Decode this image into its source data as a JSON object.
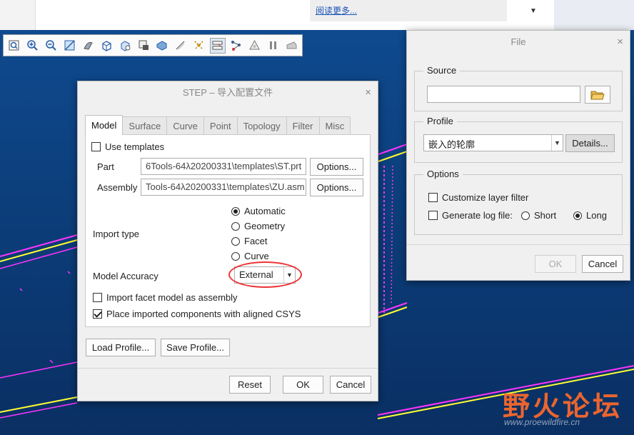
{
  "browser": {
    "read_more": "阅读更多...",
    "dropdown_arrow": "▼"
  },
  "toolbar": {
    "icons": [
      "zoom-fit-icon",
      "zoom-in-icon",
      "zoom-out-icon",
      "repaint-icon",
      "shading-icon",
      "display-style-icon",
      "saved-views-icon",
      "view-manager-icon",
      "perspective-icon",
      "datum-display-icon",
      "spin-center-icon",
      "annotation-display-icon",
      "network-icon",
      "appearance-icon",
      "pause-icon",
      "eraser-icon"
    ]
  },
  "step_dialog": {
    "title": "STEP – 导入配置文件",
    "close": "×",
    "tabs": [
      "Model",
      "Surface",
      "Curve",
      "Point",
      "Topology",
      "Filter",
      "Misc"
    ],
    "active_tab": "Model",
    "use_templates_label": "Use templates",
    "use_templates_checked": false,
    "part_label": "Part",
    "part_value": "6Tools-64λ20200331\\templates\\ST.prt",
    "assembly_label": "Assembly",
    "assembly_value": "Tools-64λ20200331\\templates\\ZU.asm",
    "options_label": "Options...",
    "import_type_label": "Import type",
    "import_types": [
      "Automatic",
      "Geometry",
      "Facet",
      "Curve"
    ],
    "import_type_selected": "Automatic",
    "model_accuracy_label": "Model Accuracy",
    "model_accuracy_value": "External",
    "import_facet_label": "Import facet model as assembly",
    "import_facet_checked": false,
    "place_aligned_label": "Place imported components with aligned CSYS",
    "place_aligned_checked": true,
    "load_profile": "Load Profile...",
    "save_profile": "Save Profile...",
    "reset": "Reset",
    "ok": "OK",
    "cancel": "Cancel"
  },
  "file_dialog": {
    "title": "File",
    "close": "×",
    "source_label": "Source",
    "source_value": "",
    "profile_label": "Profile",
    "profile_value": "嵌入的轮廓",
    "details_label": "Details...",
    "options_label": "Options",
    "customize_layer_filter": "Customize layer filter",
    "generate_log_file": "Generate log file:",
    "short_label": "Short",
    "long_label": "Long",
    "log_selected": "Long",
    "ok": "OK",
    "cancel": "Cancel"
  },
  "watermark": {
    "main": "野火论坛",
    "sub": "www.proewildfire.cn"
  },
  "colors": {
    "viewport_blue": "#0f4a8f",
    "highlight_red": "#e33333",
    "geometry_magenta": "#ff33ff",
    "geometry_yellow": "#ffff33",
    "watermark_orange": "#ff6a2a"
  }
}
